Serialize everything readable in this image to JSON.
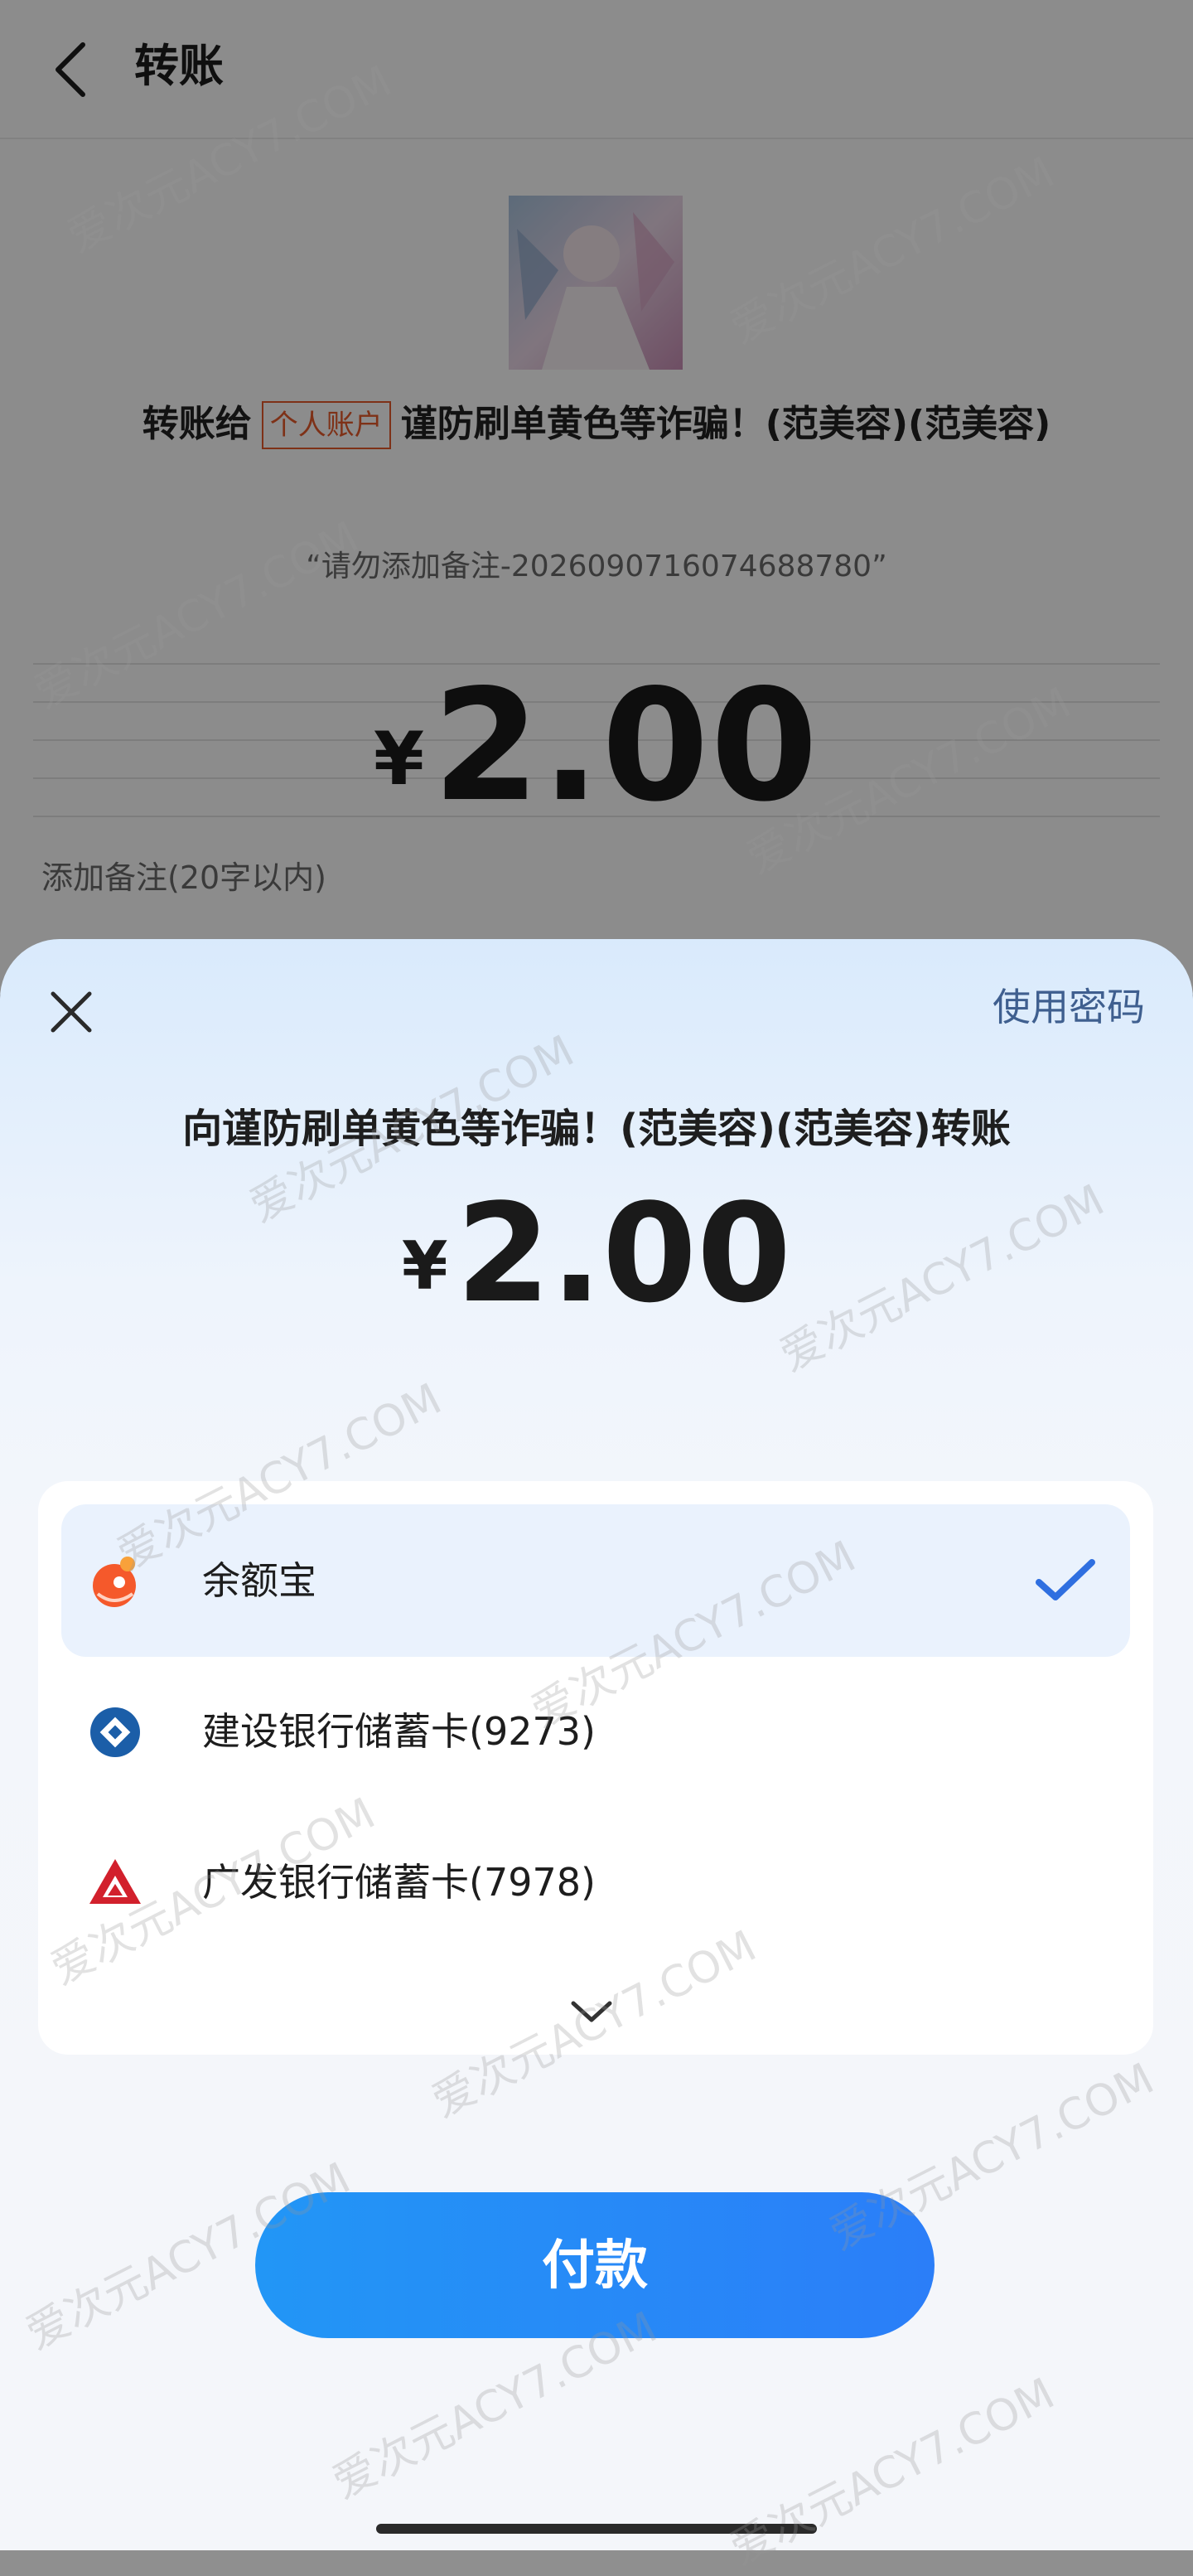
{
  "page": {
    "title": "转账",
    "recipient_prefix": "转账给",
    "account_badge": "个人账户",
    "recipient_name": "谨防刷单黄色等诈骗！(范美容)(范美容)",
    "memo_quote": "“请勿添加备注-20260907160746887 80”",
    "currency_symbol": "¥",
    "amount": "2.00",
    "memo_placeholder": "添加备注(20字以内)"
  },
  "sheet": {
    "use_password": "使用密码",
    "title": "向谨防刷单黄色等诈骗！(范美容)(范美容)转账",
    "currency_symbol": "¥",
    "amount": "2.00",
    "methods": [
      {
        "label": "余额宝",
        "icon": "yuebao-icon",
        "selected": true
      },
      {
        "label": "建设银行储蓄卡(9273)",
        "icon": "ccb-bank-icon",
        "selected": false
      },
      {
        "label": "广发银行储蓄卡(7978)",
        "icon": "cgb-bank-icon",
        "selected": false
      }
    ],
    "pay_button": "付款"
  },
  "watermark": "爱次元ACY7.COM",
  "colors": {
    "accent": "#2b7ef8",
    "badge": "#e55a2b",
    "check": "#2f6fe0"
  }
}
